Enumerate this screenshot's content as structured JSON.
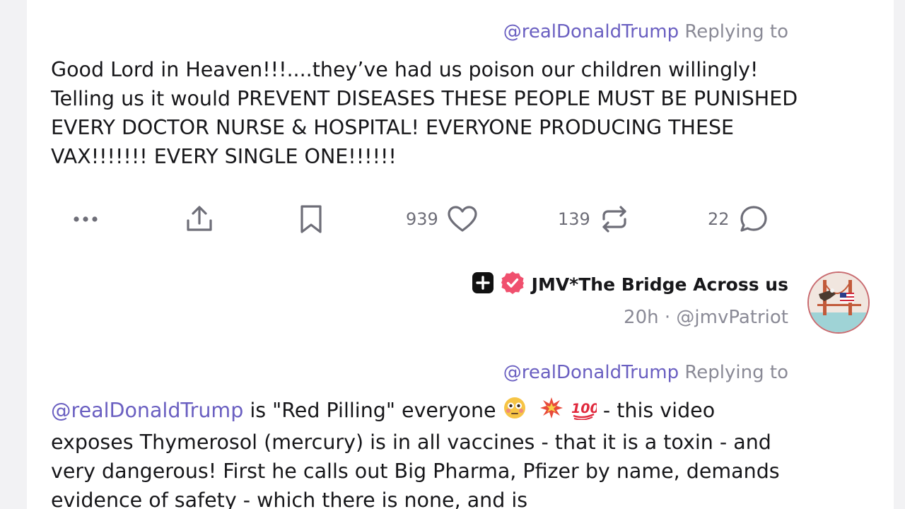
{
  "post1": {
    "mention": "@realDonaldTrump",
    "replying": "Replying to",
    "text": "Good Lord in Heaven!!!....they’ve had us poison our children willingly! Telling us it would PREVENT DISEASES THESE PEOPLE MUST BE PUNISHED EVERY DOCTOR NURSE & HOSPITAL! EVERYONE PRODUCING THESE VAX!!!!!!! EVERY SINGLE ONE!!!!!!",
    "likes": "939",
    "reposts": "139",
    "replies": "22"
  },
  "post2": {
    "author": "JMV*The Bridge Across us",
    "time": "20h",
    "separator": "·",
    "handle": "@jmvPatriot",
    "mention": "@realDonaldTrump",
    "replying": "Replying to",
    "text_mention": "@realDonaldTrump",
    "text_part1": " is \"Red Pilling\" everyone ",
    "text_part2": " - this video exposes Thymerosol (mercury) is in  all vaccines - that it is a toxin - and very dangerous!  First he calls out Big Pharma, Pfizer by name, demands evidence of safety - which there is none, and is"
  },
  "icons": {
    "more": "more-dots-icon",
    "share": "share-upload-icon",
    "bookmark": "bookmark-icon",
    "like": "heart-icon",
    "repost": "repost-icon",
    "reply": "reply-bubble-icon",
    "plus_badge": "plus-badge-icon",
    "verified": "verified-badge-icon"
  },
  "colors": {
    "mention": "#6a5fc1",
    "muted": "#8a8a96",
    "verified": "#f0506e"
  }
}
